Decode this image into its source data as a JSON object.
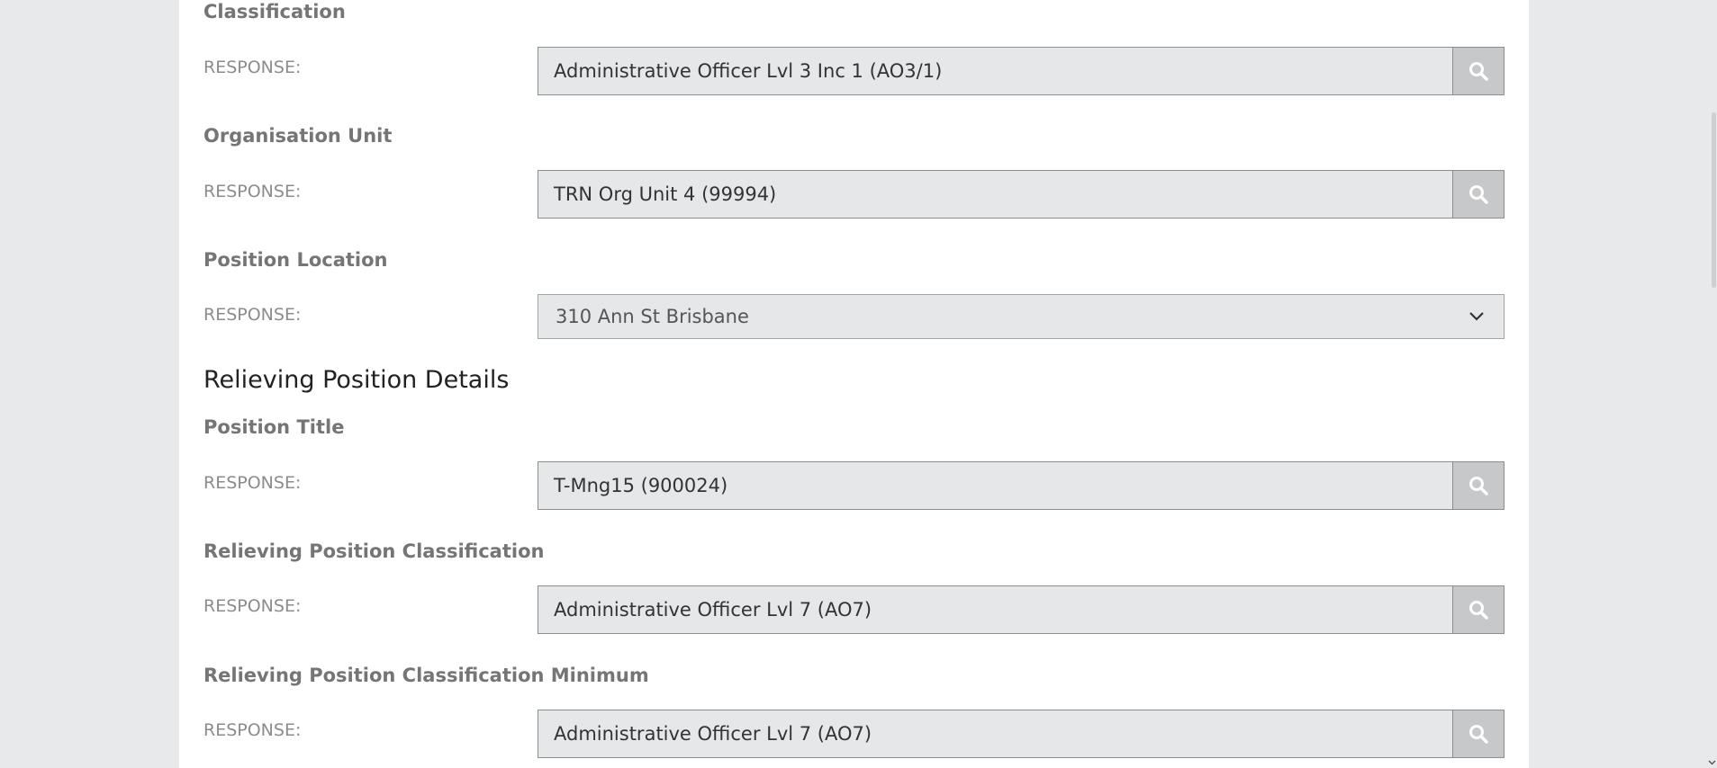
{
  "form": {
    "fields": [
      {
        "question": "Classification",
        "response_label": "RESPONSE:",
        "value": "Administrative Officer Lvl 3 Inc 1 (AO3/1)",
        "control": "lookup"
      },
      {
        "question": "Organisation Unit",
        "response_label": "RESPONSE:",
        "value": "TRN Org Unit 4 (99994)",
        "control": "lookup"
      },
      {
        "question": "Position Location",
        "response_label": "RESPONSE:",
        "value": "310 Ann St Brisbane",
        "control": "select"
      }
    ],
    "section_heading": "Relieving Position Details",
    "relieving_fields": [
      {
        "question": "Position Title",
        "response_label": "RESPONSE:",
        "value": "T-Mng15 (900024)",
        "control": "lookup"
      },
      {
        "question": "Relieving Position Classification",
        "response_label": "RESPONSE:",
        "value": "Administrative Officer Lvl 7 (AO7)",
        "control": "lookup"
      },
      {
        "question": "Relieving Position Classification Minimum",
        "response_label": "RESPONSE:",
        "value": "Administrative Officer Lvl 7 (AO7)",
        "control": "lookup"
      }
    ]
  },
  "icons": {
    "lookup_button": "search-icon",
    "select_toggle": "chevron-down-icon"
  },
  "colors": {
    "page_background": "#e8e9ea",
    "panel_background": "#ffffff",
    "field_background": "#e6e7e9",
    "button_background": "#c7c8ca",
    "label_text": "#757575"
  }
}
